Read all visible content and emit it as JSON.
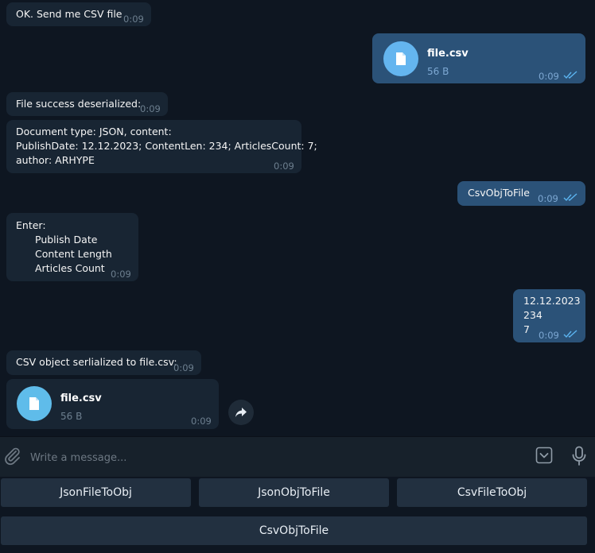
{
  "messages": {
    "m1": {
      "text": "OK. Send me CSV file",
      "time": "0:09"
    },
    "m2": {
      "file_name": "file.csv",
      "file_size": "56 B",
      "time": "0:09"
    },
    "m3": {
      "text": "File success deserialized:",
      "time": "0:09"
    },
    "m4": {
      "line1": "Document type: JSON, content:",
      "line2": "PublishDate: 12.12.2023; ContentLen: 234; ArticlesCount: 7;",
      "line3": "author: ARHYPE",
      "time": "0:09"
    },
    "m5": {
      "text": "CsvObjToFile",
      "time": "0:09"
    },
    "m6": {
      "line1": "Enter:",
      "line2": "Publish Date",
      "line3": "Content Length",
      "line4": "Articles Count",
      "time": "0:09"
    },
    "m7": {
      "line1": "12.12.2023",
      "line2": "234",
      "line3": "7",
      "time": "0:09"
    },
    "m8": {
      "text": "CSV object serlialized to file.csv:",
      "time": "0:09"
    },
    "m9": {
      "file_name": "file.csv",
      "file_size": "56 B",
      "time": "0:09"
    }
  },
  "composer": {
    "placeholder": "Write a message..."
  },
  "keyboard": {
    "row1": [
      "JsonFileToObj",
      "JsonObjToFile",
      "CsvFileToObj"
    ],
    "row2": [
      "CsvObjToFile"
    ]
  },
  "icons": {
    "file": "document-icon",
    "read": "double-check-icon",
    "share": "forward-arrow-icon",
    "attach": "paperclip-icon",
    "keyboard": "keyboard-toggle-icon",
    "mic": "microphone-icon"
  },
  "colors": {
    "background": "#0e1621",
    "incoming_bubble": "#182533",
    "outgoing_bubble": "#2b5278",
    "file_icon": "#5fbcea",
    "read_ticks": "#5bb4f0",
    "panel": "#17212b",
    "keyboard_button": "#223040"
  }
}
